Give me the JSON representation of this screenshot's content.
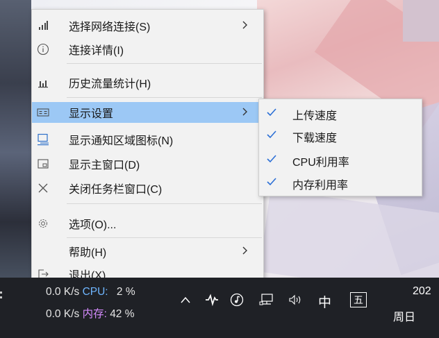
{
  "menu": {
    "items": [
      {
        "icon": "signal-bars-icon",
        "label": "选择网络连接(S)",
        "has_submenu": true
      },
      {
        "icon": "info-icon",
        "label": "连接详情(I)",
        "has_submenu": false
      },
      {
        "icon": "bar-chart-icon",
        "label": "历史流量统计(H)",
        "has_submenu": false
      },
      {
        "icon": "display-settings-icon",
        "label": "显示设置",
        "has_submenu": true,
        "highlighted": true
      },
      {
        "icon": "notification-area-icon",
        "label": "显示通知区域图标(N)",
        "has_submenu": false
      },
      {
        "icon": "main-window-icon",
        "label": "显示主窗口(D)",
        "has_submenu": false
      },
      {
        "icon": "close-icon",
        "label": "关闭任务栏窗口(C)",
        "has_submenu": false
      },
      {
        "icon": "gear-icon",
        "label": "选项(O)...",
        "has_submenu": false
      },
      {
        "icon": "",
        "label": "帮助(H)",
        "has_submenu": true
      },
      {
        "icon": "exit-icon",
        "label": "退出(X)",
        "has_submenu": false
      }
    ],
    "highlight_color": "#9cc8f5"
  },
  "submenu": {
    "items": [
      {
        "label": "上传速度",
        "checked": true
      },
      {
        "label": "下载速度",
        "checked": true
      },
      {
        "label": "CPU利用率",
        "checked": true
      },
      {
        "label": "内存利用率",
        "checked": true
      }
    ],
    "check_color": "#2b6fd6"
  },
  "taskbar": {
    "up_speed": "0.0 K/s",
    "cpu_label": "CPU:",
    "cpu_value": "2 %",
    "down_speed": "0.0 K/s",
    "mem_label": "内存:",
    "mem_value": "42 %",
    "tray_icons": [
      "chevron-up-icon",
      "pulse-icon",
      "music-icon",
      "network-icon",
      "volume-icon"
    ],
    "ime_lang": "中",
    "ime_mode": "五",
    "clock_year": "202",
    "clock_day": "周日"
  }
}
